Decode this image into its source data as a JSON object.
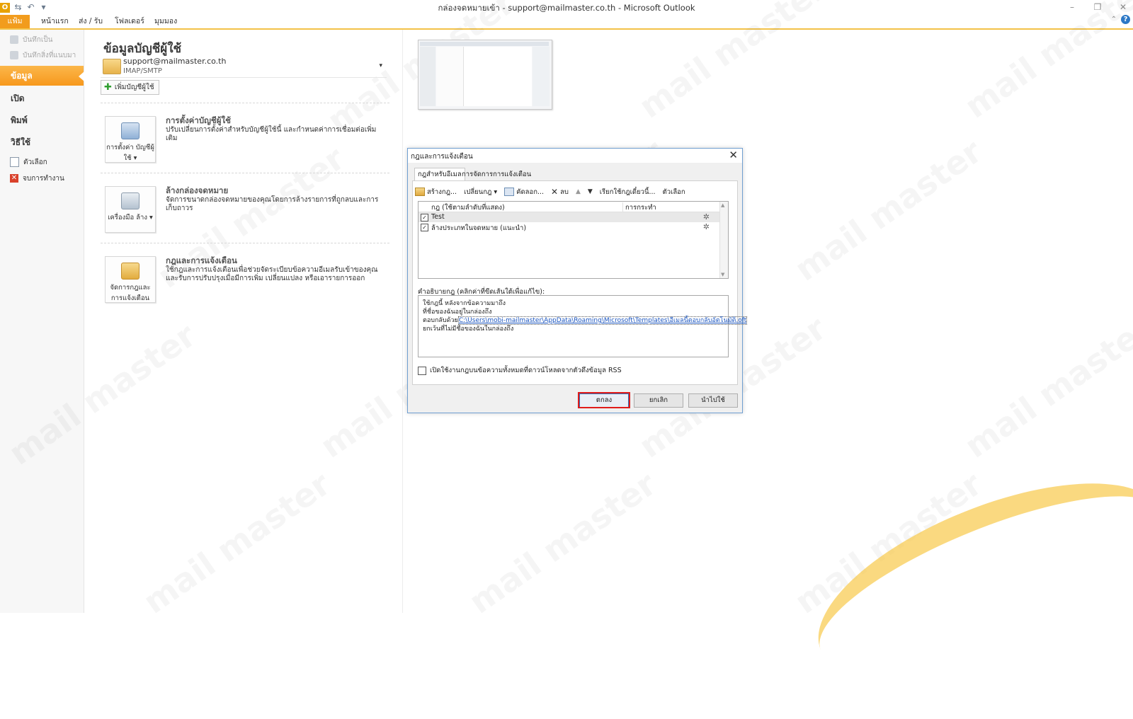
{
  "window": {
    "title": "กล่องจดหมายเข้า - support@mailmaster.co.th  -  Microsoft Outlook",
    "app_icon": "O"
  },
  "ribbon": {
    "tabs": [
      "แฟ้ม",
      "หน้าแรก",
      "ส่ง / รับ",
      "โฟลเดอร์",
      "มุมมอง"
    ]
  },
  "sidebar": {
    "save": "บันทึกเป็น",
    "save_attach": "บันทึกสิ่งที่แนบมา",
    "info": "ข้อมูล",
    "open": "เปิด",
    "print": "พิมพ์",
    "help": "วิธีใช้",
    "options": "ตัวเลือก",
    "exit": "จบการทำงาน"
  },
  "info": {
    "title": "ข้อมูลบัญชีผู้ใช้",
    "account_email": "support@mailmaster.co.th",
    "account_type": "IMAP/SMTP",
    "add_account": "เพิ่มบัญชีผู้ใช้",
    "sections": [
      {
        "button": "การตั้งค่า บัญชีผู้ใช้ ▾",
        "title": "การตั้งค่าบัญชีผู้ใช้",
        "desc": "ปรับเปลี่ยนการตั้งค่าสำหรับบัญชีผู้ใช้นี้ และกำหนดค่าการเชื่อมต่อเพิ่มเติม"
      },
      {
        "button": "เครื่องมือ ล้าง ▾",
        "title": "ล้างกล่องจดหมาย",
        "desc": "จัดการขนาดกล่องจดหมายของคุณโดยการล้างรายการที่ถูกลบและการเก็บถาวร"
      },
      {
        "button": "จัดการกฎและ การแจ้งเตือน",
        "title": "กฎและการแจ้งเตือน",
        "desc": "ใช้กฎและการแจ้งเตือนเพื่อช่วยจัดระเบียบข้อความอีเมลรับเข้าของคุณ และรับการปรับปรุงเมื่อมีการเพิ่ม เปลี่ยนแปลง หรือเอารายการออก"
      }
    ]
  },
  "dialog": {
    "title": "กฎและการแจ้งเตือน",
    "tabs": [
      "กฎสำหรับอีเมล",
      "การจัดการการแจ้งเตือน"
    ],
    "toolbar": {
      "new_rule": "สร้างกฎ...",
      "change_rule": "เปลี่ยนกฎ ▾",
      "copy": "คัดลอก...",
      "delete": "ลบ",
      "run_rules": "เรียกใช้กฎเดี๋ยวนี้...",
      "options": "ตัวเลือก"
    },
    "columns": [
      "กฎ (ใช้ตามลำดับที่แสดง)",
      "การกระทำ"
    ],
    "rules": [
      {
        "name": "Test",
        "checked": true
      },
      {
        "name": "ล้างประเภทในจดหมาย (แนะนำ)",
        "checked": true
      }
    ],
    "desc_label": "คำอธิบายกฎ (คลิกค่าที่ขีดเส้นใต้เพื่อแก้ไข):",
    "desc_lines": [
      "ใช้กฎนี้ หลังจากข้อความมาถึง",
      "ที่ชื่อของฉันอยู่ในกล่องถึง",
      "ตอบกลับด้วย",
      "ยกเว้นที่ไม่มีชื่อของฉันในกล่องถึง"
    ],
    "desc_link": "C:\\Users\\mobi-mailmaster\\AppData\\Roaming\\Microsoft\\Templates\\อีเมลนี้ตอบกลับอัตโนมัติ.oft",
    "rss_label": "เปิดใช้งานกฎบนข้อความทั้งหมดที่ดาวน์โหลดจากตัวดึงข้อมูล RSS",
    "buttons": {
      "ok": "ตกลง",
      "cancel": "ยกเลิก",
      "apply": "นำไปใช้"
    }
  },
  "watermark": "mail master"
}
